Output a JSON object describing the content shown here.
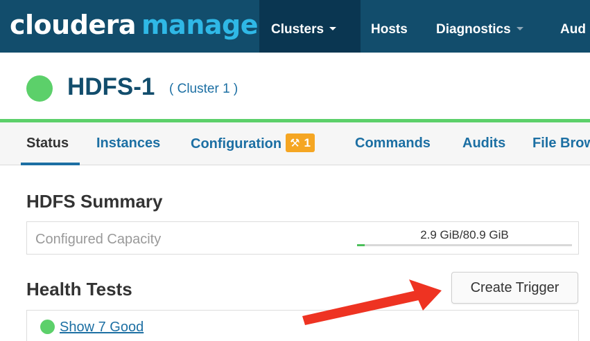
{
  "app": {
    "logo_part1": "cloudera",
    "logo_part2": "manager",
    "brand_colors": {
      "navbar": "#124d6c",
      "logo_accent": "#2fb8e6",
      "active_nav": "#0a3651"
    }
  },
  "nav": {
    "clusters": "Clusters",
    "hosts": "Hosts",
    "diagnostics": "Diagnostics",
    "audits": "Aud"
  },
  "cluster": {
    "name": "HDFS-1",
    "subtitle": "( Cluster 1 )",
    "status_color": "#5cd06a"
  },
  "tabs": {
    "status": "Status",
    "instances": "Instances",
    "configuration": "Configuration",
    "configuration_badge_icon": "tools-icon",
    "configuration_badge_count": "1",
    "commands": "Commands",
    "audits": "Audits",
    "file_browser": "File Brow"
  },
  "summary": {
    "title": "HDFS Summary",
    "capacity_label": "Configured Capacity",
    "capacity_value": "2.9 GiB/80.9 GiB",
    "capacity_fraction": 0.036
  },
  "health": {
    "title": "Health Tests",
    "create_trigger": "Create Trigger",
    "show_good": "Show 7 Good"
  },
  "annotation": {
    "arrow_color": "#ee3322"
  }
}
